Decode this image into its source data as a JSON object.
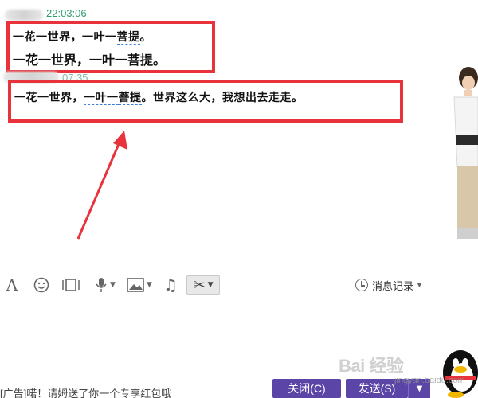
{
  "chat": {
    "messages": [
      {
        "timestamp": "22:03:06",
        "vertical_text_a": "一花一世界，一叶一",
        "vertical_text_b": "菩提",
        "vertical_text_c": "。",
        "line2": "一花一世界，一叶一菩提。"
      },
      {
        "timestamp": "07:35",
        "text_a": "一花一世界，",
        "text_b": "一叶一",
        "text_c": "菩提",
        "text_d": "。世界这么大，我想出去走走。"
      }
    ]
  },
  "toolbar": {
    "items": [
      {
        "icon": "font-icon",
        "glyph": "A"
      },
      {
        "icon": "emoji-icon",
        "glyph": "☺"
      },
      {
        "icon": "video-icon"
      },
      {
        "icon": "microphone-icon"
      },
      {
        "icon": "image-icon"
      },
      {
        "icon": "music-icon",
        "glyph": "♫"
      },
      {
        "icon": "screenshot-scissors-icon",
        "glyph": "✂"
      }
    ],
    "history_label": "消息记录"
  },
  "footer": {
    "ad_text": "[广告]喏！请姆送了你一个专享红包哦",
    "close_label": "关闭(C)",
    "send_label": "发送(S)"
  },
  "watermark": {
    "text": "Bai 经验",
    "url": "jingyan.baidu.com"
  },
  "colors": {
    "accent_purple": "#5b46a8",
    "annotation_red": "#e8323c",
    "timestamp_green": "#2e9c6e"
  }
}
